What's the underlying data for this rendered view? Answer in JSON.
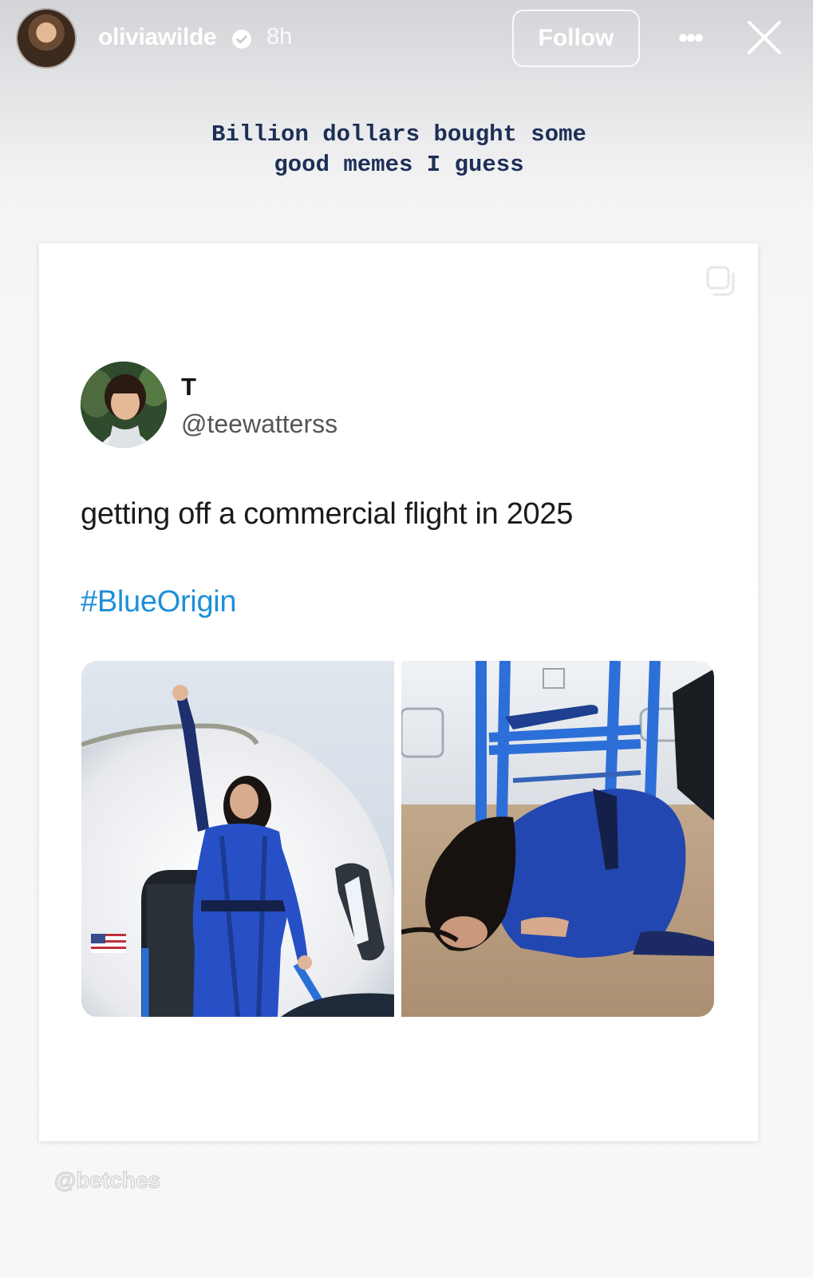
{
  "story": {
    "username": "oliviawilde",
    "time_ago": "8h",
    "follow_label": "Follow",
    "more_icon": "more-horizontal-icon",
    "close_icon": "close-icon",
    "verified_icon": "verified-badge-icon"
  },
  "caption": {
    "line1": "Billion dollars bought some",
    "line2": "good memes I guess"
  },
  "tweet": {
    "display_name": "T",
    "handle": "@teewatterss",
    "text": "getting off a commercial flight in 2025",
    "hashtag": "#BlueOrigin",
    "hashtag_color": "#1d8fd9",
    "photo_left_alt": "Woman in blue flight suit raising arm while exiting capsule",
    "photo_right_alt": "Woman in blue flight suit kneeling and kissing the ground"
  },
  "watermark": "@betches"
}
